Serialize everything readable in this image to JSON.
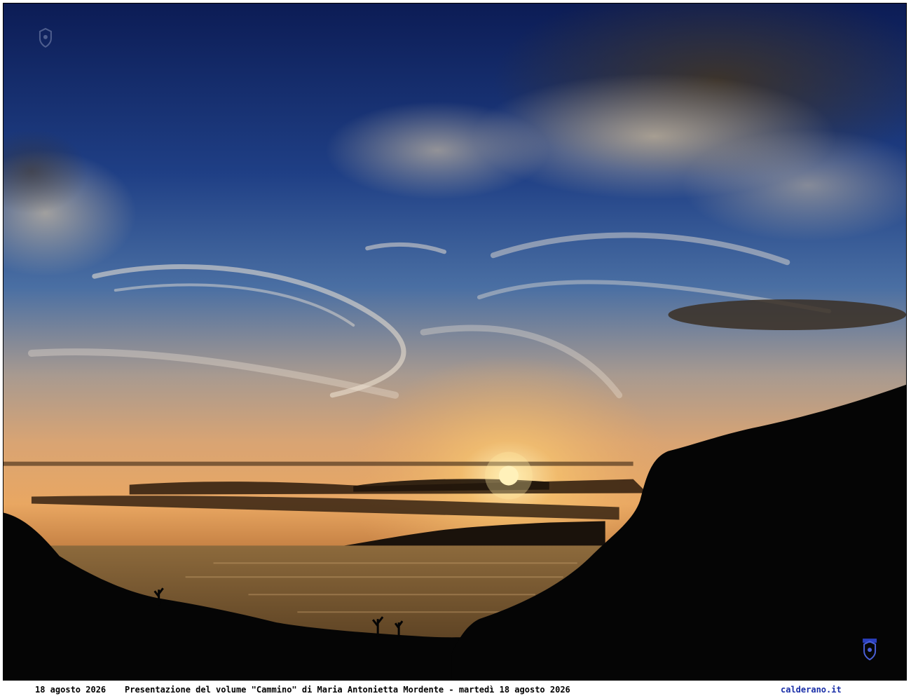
{
  "photo": {
    "subject": "sunset",
    "palette": {
      "sky_top": "#0f2466",
      "sky_mid": "#2f5a9a",
      "horizon": "#e8a35a",
      "sun": "#fff2b0",
      "sea": "#7a5830",
      "silhouette": "#050505"
    }
  },
  "watermarks": {
    "top_left_icon": "crest-icon",
    "bottom_right_icon": "crest-icon"
  },
  "caption": {
    "date": "18 agosto 2026",
    "text": "Presentazione del volume \"Cammino\" di Maria Antonietta Mordente - martedì 18 agosto 2026",
    "site": "calderano.it"
  }
}
